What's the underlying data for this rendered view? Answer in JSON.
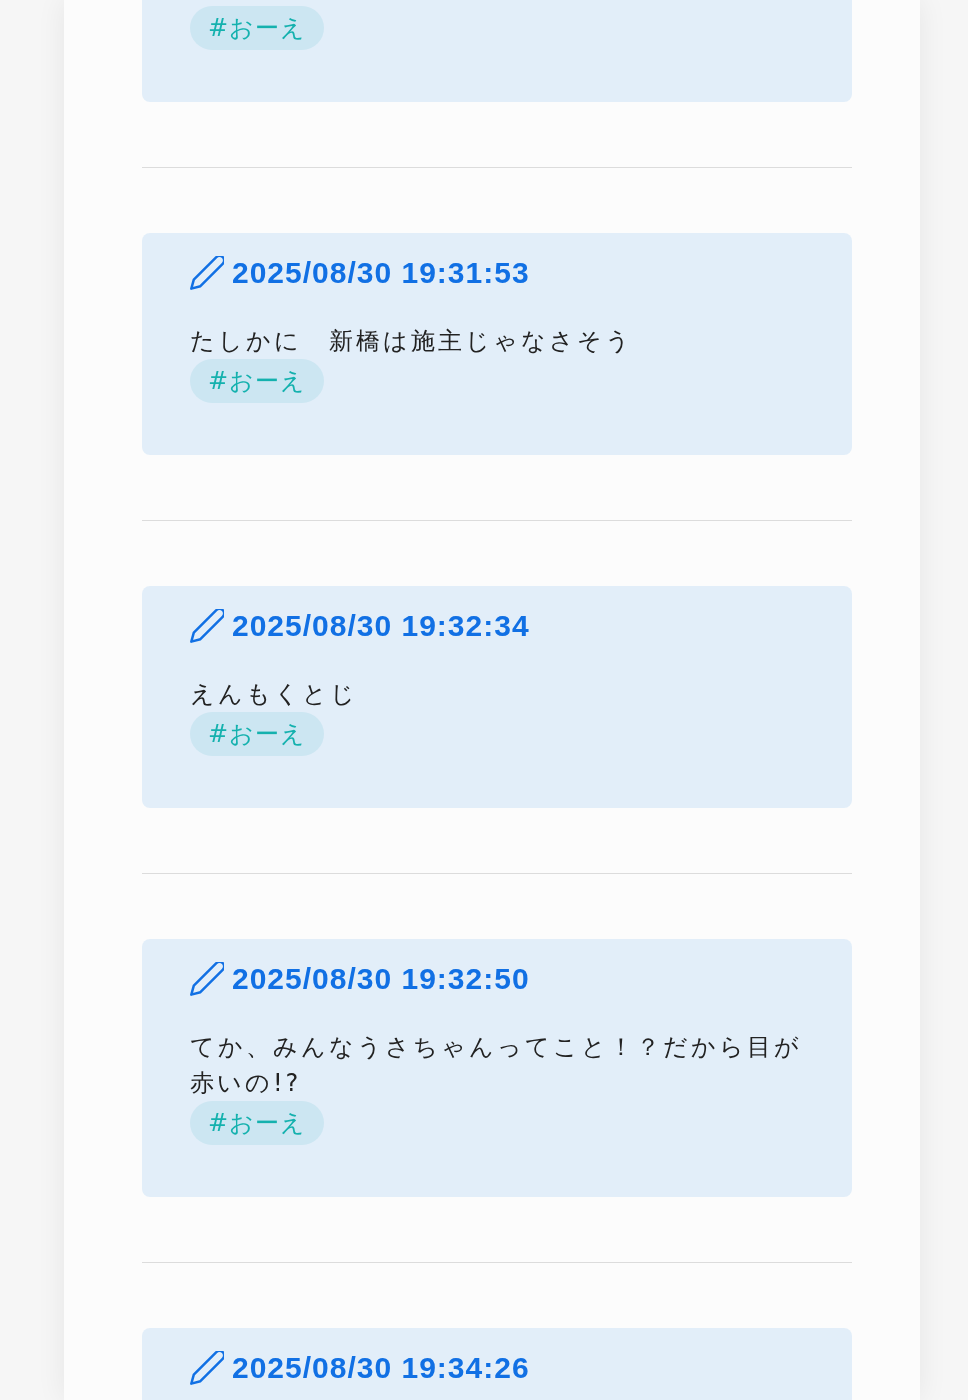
{
  "posts": [
    {
      "tags": [
        "#おーえ"
      ]
    },
    {
      "timestamp": "2025/08/30 19:31:53",
      "text": "たしかに　新橋は施主じゃなさそう",
      "tags": [
        "#おーえ"
      ]
    },
    {
      "timestamp": "2025/08/30 19:32:34",
      "text": "えんもくとじ",
      "tags": [
        "#おーえ"
      ]
    },
    {
      "timestamp": "2025/08/30 19:32:50",
      "text": "てか、みんなうさちゃんってこと！？だから目が赤いの!?",
      "tags": [
        "#おーえ"
      ]
    },
    {
      "timestamp": "2025/08/30 19:34:26"
    }
  ]
}
